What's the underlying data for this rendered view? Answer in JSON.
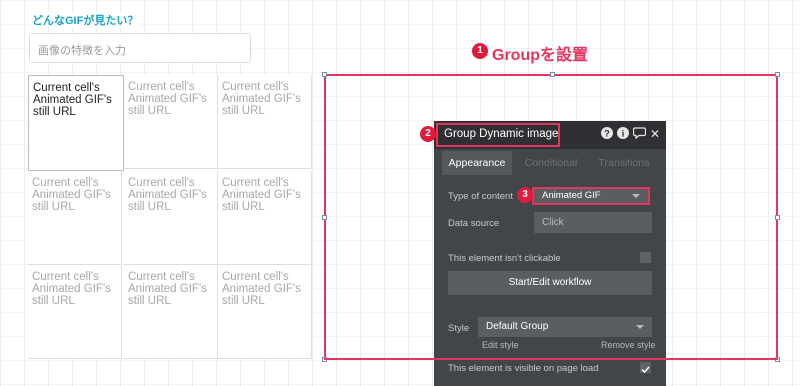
{
  "question": "どんなGIFが見たい？",
  "search": {
    "placeholder": "画像の特徴を入力"
  },
  "grid": {
    "cells": [
      "Current cell's Animated GIF's still URL",
      "Current cell's Animated GIF's still URL",
      "Current cell's Animated GIF's still URL",
      "Current cell's Animated GIF's still URL",
      "Current cell's Animated GIF's still URL",
      "Current cell's Animated GIF's still URL",
      "Current cell's Animated GIF's still URL",
      "Current cell's Animated GIF's still URL",
      "Current cell's Animated GIF's still URL"
    ]
  },
  "annotations": {
    "b1": "1",
    "b2": "2",
    "b3": "3",
    "callout": "Groupを設置"
  },
  "panel": {
    "title": "Group Dynamic image",
    "icons": {
      "help": "?",
      "info": "i",
      "comment": "comment-icon",
      "close": "✕"
    },
    "tabs": [
      "Appearance",
      "Conditional",
      "Transitions"
    ],
    "type_label": "Type of content",
    "type_value": "Animated GIF",
    "source_label": "Data source",
    "source_value": "Click",
    "clickable_label": "This element isn't clickable",
    "workflow_button": "Start/Edit workflow",
    "style_label": "Style",
    "style_value": "Default Group",
    "edit_style": "Edit style",
    "remove_style": "Remove style",
    "visible_label": "This element is visible on page load",
    "visible_checked": true
  }
}
